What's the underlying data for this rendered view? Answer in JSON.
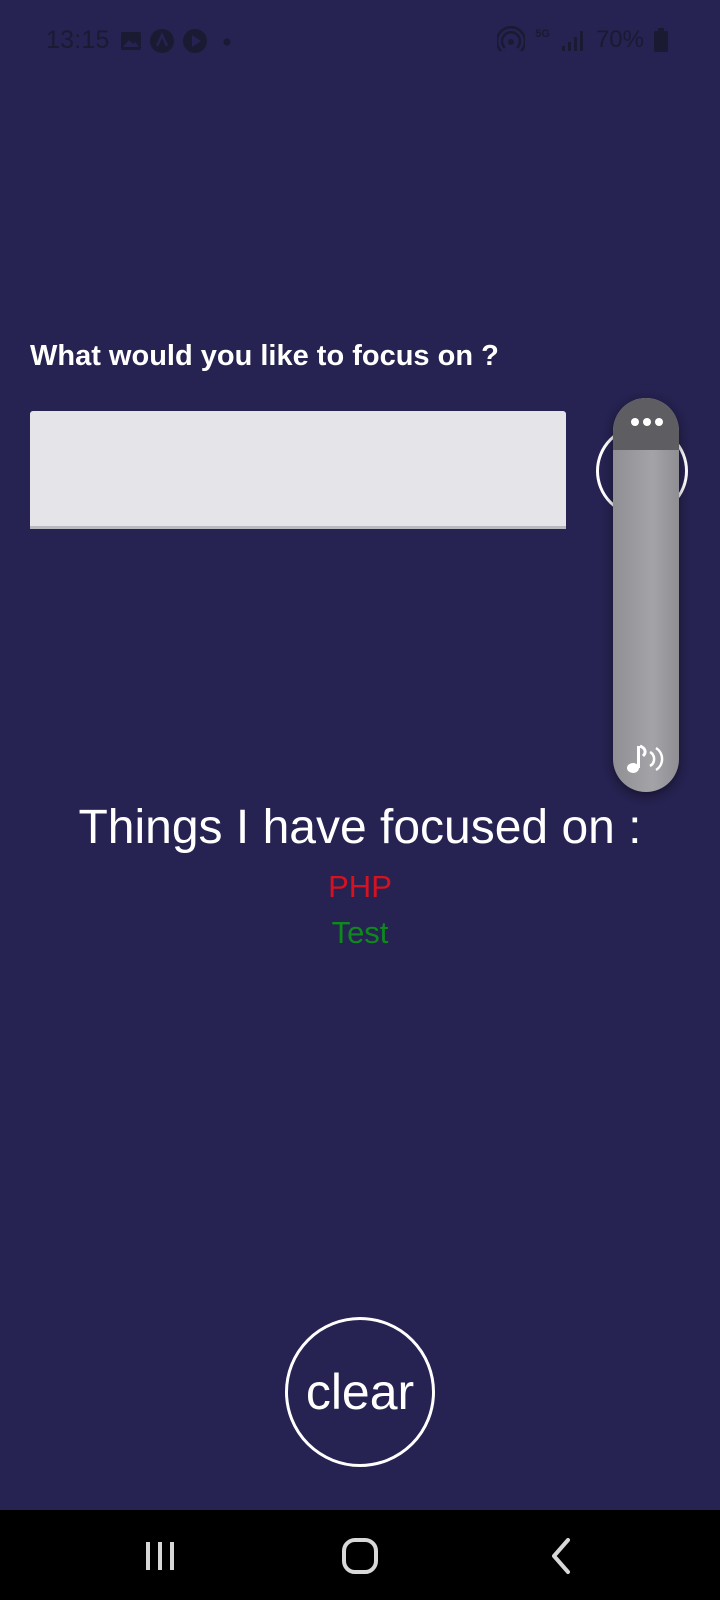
{
  "status_bar": {
    "time": "13:15",
    "battery": "70%",
    "network_label": "5G",
    "icons": [
      "gallery-icon",
      "a-icon",
      "play-icon",
      "dot-icon",
      "hotspot-icon",
      "signal-icon",
      "battery-icon"
    ]
  },
  "main": {
    "prompt": "What would you like to focus on ?",
    "input": {
      "value": "",
      "placeholder": ""
    },
    "focused_heading": "Things I have focused on :",
    "focused_items": [
      {
        "label": "PHP",
        "color": "#d5121f"
      },
      {
        "label": "Test",
        "color": "#0e8a1c"
      }
    ],
    "clear_label": "clear"
  },
  "colors": {
    "background": "#262251",
    "input_bg": "#e5e5e9",
    "panel_bg": "#9a9a9f"
  },
  "nav_bar": {
    "icons": [
      "recent-apps-icon",
      "home-icon",
      "back-icon"
    ]
  }
}
